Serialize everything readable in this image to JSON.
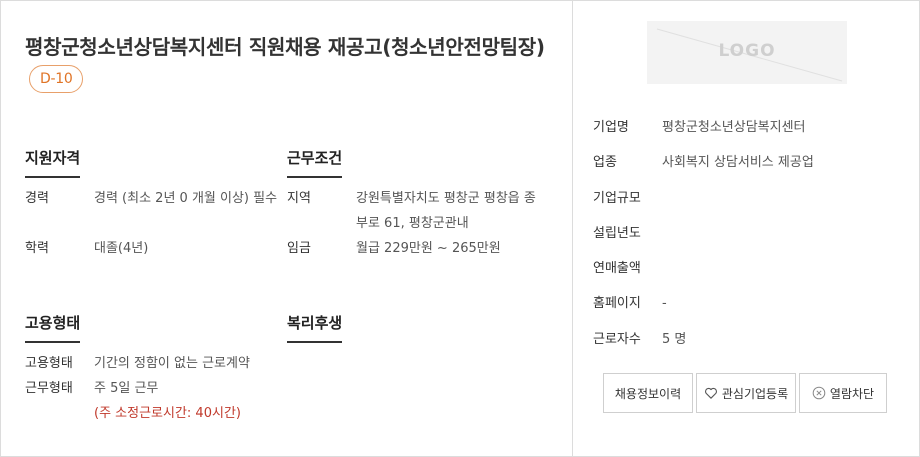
{
  "job": {
    "title": "평창군청소년상담복지센터 직원채용 재공고(청소년안전망팀장)",
    "dday": "D-10"
  },
  "sections": {
    "qualification": {
      "title": "지원자격",
      "career_label": "경력",
      "career_value": "경력 (최소 2년 0 개월 이상) 필수",
      "education_label": "학력",
      "education_value": "대졸(4년)"
    },
    "conditions": {
      "title": "근무조건",
      "region_label": "지역",
      "region_value": "강원특별자치도 평창군 평창읍 종부로 61, 평창군관내",
      "salary_label": "임금",
      "salary_value": "월급 229만원 ~ 265만원"
    },
    "employment": {
      "title": "고용형태",
      "type_label": "고용형태",
      "type_value": "기간의 정함이 없는 근로계약",
      "work_label": "근무형태",
      "work_value": "주 5일 근무",
      "work_note": "(주 소정근로시간: 40시간)"
    },
    "welfare": {
      "title": "복리후생"
    }
  },
  "company": {
    "logo_text": "LOGO",
    "name_label": "기업명",
    "name_value": "평창군청소년상담복지센터",
    "industry_label": "업종",
    "industry_value": "사회복지 상담서비스 제공업",
    "size_label": "기업규모",
    "size_value": "",
    "founded_label": "설립년도",
    "founded_value": "",
    "revenue_label": "연매출액",
    "revenue_value": "",
    "homepage_label": "홈페이지",
    "homepage_value": "-",
    "employees_label": "근로자수",
    "employees_value": "5 명"
  },
  "buttons": {
    "history": "채용정보이력",
    "favorite": "관심기업등록",
    "block": "열람차단"
  },
  "colors": {
    "accent": "#e07426",
    "note": "#c0392b"
  }
}
